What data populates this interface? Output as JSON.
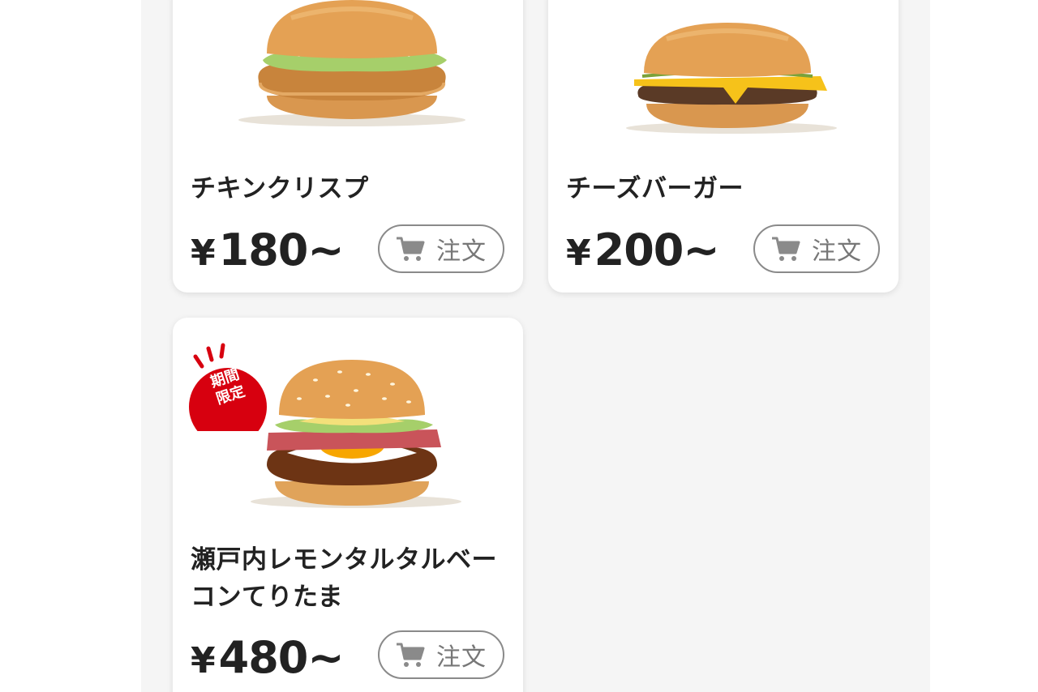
{
  "menu": {
    "order_label": "注文",
    "items": [
      {
        "name": "チキンクリスプ",
        "yen": "¥",
        "price": "180~",
        "image": "chicken-crisp-burger"
      },
      {
        "name": "チーズバーガー",
        "yen": "¥",
        "price": "200~",
        "image": "cheeseburger"
      },
      {
        "name": "瀬戸内レモンタルタルベーコンてりたま",
        "yen": "¥",
        "price": "480~",
        "image": "teritama-burger",
        "badge": {
          "line1": "期間",
          "line2": "限定"
        }
      }
    ]
  },
  "colors": {
    "background": "#f5f5f5",
    "card": "#ffffff",
    "badge_red": "#d7000f",
    "button_border": "#8a8a8a"
  },
  "icons": {
    "cart": "cart-icon"
  }
}
